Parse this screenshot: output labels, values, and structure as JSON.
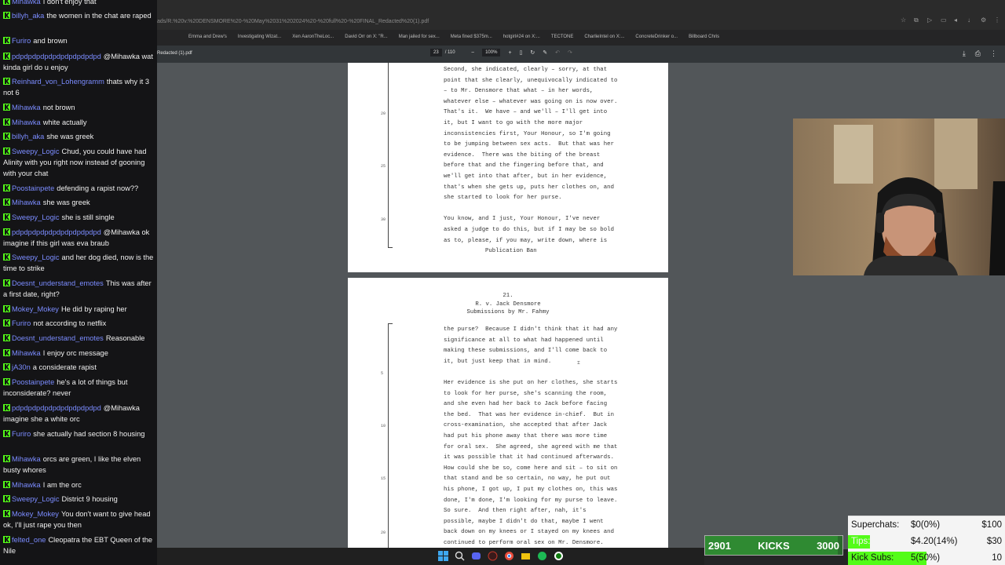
{
  "browser": {
    "url": "ads/R.%20v.%20DENSMORE%20-%20May%2031%202024%20-%20full%20-%20FINAL_Redacted%20(1).pdf",
    "bookmarks": [
      "Emma and Drew's",
      "Investigating Wizat...",
      "Xen AaronTheLoc...",
      "David Orr on X: \"R...",
      "Man jailed for sex...",
      "Meta fined $375m...",
      "hotgirl#24 on X:...",
      "TECTONE",
      "CharlieIntel on X:...",
      "ConcreteDrinker o...",
      "Billboard Chris"
    ]
  },
  "pdf_toolbar": {
    "filename": "Redacted (1).pdf",
    "current_page": "23",
    "total_pages": "/ 110",
    "zoom": "100%"
  },
  "page1": {
    "lines": [
      "Second, she indicated, clearly – sorry, at that",
      "point that she clearly, unequivocally indicated to",
      "– to Mr. Densmore that what – in her words,",
      "whatever else – whatever was going on is now over.",
      "That's it.  We have – and we'll – I'll get into",
      "it, but I want to go with the more major",
      "inconsistencies first, Your Honour, so I'm going",
      "to be jumping between sex acts.  But that was her",
      "evidence.  There was the biting of the breast",
      "before that and the fingering before that, and",
      "we'll get into that after, but in her evidence,",
      "that's when she gets up, puts her clothes on, and",
      "she started to look for her purse.",
      "",
      "You know, and I just, Your Honour, I've never",
      "asked a judge to do this, but if I may be so bold",
      "as to, please, if you may, write down, where is"
    ],
    "footer": "Publication Ban",
    "line_numbers": [
      "20",
      "25",
      "30"
    ]
  },
  "page2": {
    "page_no": "21.",
    "header_line1": "R. v. Jack Densmore",
    "header_line2": "Submissions by Mr. Fahmy",
    "lines": [
      "the purse?  Because I didn't think that it had any",
      "significance at all to what had happened until",
      "making these submissions, and I'll come back to",
      "it, but just keep that in mind.",
      "",
      "Her evidence is she put on her clothes, she starts",
      "to look for her purse, she's scanning the room,",
      "and she even had her back to Jack before facing",
      "the bed.  That was her evidence in-chief.  But in",
      "cross-examination, she accepted that after Jack",
      "had put his phone away that there was more time",
      "for oral sex.  She agreed, she agreed with me that",
      "it was possible that it had continued afterwards.",
      "How could she be so, come here and sit – to sit on",
      "that stand and be so certain, no way, he put out",
      "his phone, I got up, I put my clothes on, this was",
      "done, I'm done, I'm looking for my purse to leave.",
      "So sure.  And then right after, nah, it's",
      "possible, maybe I didn't do that, maybe I went",
      "back down on my knees or I stayed on my knees and",
      "continued to perform oral sex on Mr. Densmore."
    ],
    "line_numbers": [
      "5",
      "10",
      "15",
      "20"
    ]
  },
  "chat": [
    {
      "user": "Mihawka",
      "text": "I don't enjoy that",
      "color": "#7b8cff"
    },
    {
      "user": "billyh_aka",
      "text": "the women in the chat are raped",
      "color": "#7b8cff"
    },
    {
      "user": "Furiro",
      "text": "and brown",
      "color": "#7b8cff"
    },
    {
      "user": "pdpdpdpdpdpdpdpdpdpdpd",
      "text": "@Mihawka wat kinda girl do u enjoy",
      "color": "#7b8cff"
    },
    {
      "user": "Reinhard_von_Lohengramm",
      "text": "thats why it 3 not 6",
      "color": "#7b8cff"
    },
    {
      "user": "Mihawka",
      "text": "not brown",
      "color": "#7b8cff"
    },
    {
      "user": "Mihawka",
      "text": "white actually",
      "color": "#7b8cff"
    },
    {
      "user": "billyh_aka",
      "text": "she was greek",
      "color": "#7b8cff"
    },
    {
      "user": "Sweepy_Logic",
      "text": "Chud, you could have had Alinity with you right now instead of gooning with your chat",
      "color": "#7b8cff"
    },
    {
      "user": "Poostainpete",
      "text": "defending a rapist now??",
      "color": "#7b8cff"
    },
    {
      "user": "Mihawka",
      "text": "she was greek",
      "color": "#7b8cff"
    },
    {
      "user": "Sweepy_Logic",
      "text": "she is still single",
      "color": "#7b8cff"
    },
    {
      "user": "pdpdpdpdpdpdpdpdpdpdpd",
      "text": "@Mihawka ok imagine if this girl was eva braub",
      "color": "#7b8cff"
    },
    {
      "user": "Sweepy_Logic",
      "text": "and her dog died, now is the time to strike",
      "color": "#7b8cff"
    },
    {
      "user": "Doesnt_understand_emotes",
      "text": "This was after a first date, right?",
      "color": "#7b8cff"
    },
    {
      "user": "Mokey_Mokey",
      "text": "He did by raping her",
      "color": "#7b8cff"
    },
    {
      "user": "Furiro",
      "text": "not according to netflix",
      "color": "#7b8cff"
    },
    {
      "user": "Doesnt_understand_emotes",
      "text": "Reasonable",
      "color": "#7b8cff"
    },
    {
      "user": "Mihawka",
      "text": "I enjoy orc message",
      "color": "#7b8cff"
    },
    {
      "user": "jA30n",
      "text": "a considerate rapist",
      "color": "#7b8cff"
    },
    {
      "user": "Poostainpete",
      "text": "he's a lot of things but inconsiderate? never",
      "color": "#7b8cff"
    },
    {
      "user": "pdpdpdpdpdpdpdpdpdpdpd",
      "text": "@Mihawka imagine she a white orc",
      "color": "#7b8cff"
    },
    {
      "user": "Furiro",
      "text": "she actually had section 8 housing",
      "color": "#7b8cff"
    },
    {
      "user": "Mihawka",
      "text": "orcs are green, I like the elven busty whores",
      "color": "#7b8cff"
    },
    {
      "user": "Mihawka",
      "text": "I am the orc",
      "color": "#7b8cff"
    },
    {
      "user": "Sweepy_Logic",
      "text": "District 9 housing",
      "color": "#7b8cff"
    },
    {
      "user": "Mokey_Mokey",
      "text": "You don't want to give head ok, I'll just rape you then",
      "color": "#7b8cff"
    },
    {
      "user": "felted_one",
      "text": "Cleopatra the EBT Queen of the Nile",
      "color": "#7b8cff"
    }
  ],
  "kicks": {
    "current": "2901",
    "label": "KICKS",
    "target": "3000",
    "progress": 0.967
  },
  "goals": [
    {
      "label": "Superchats:",
      "value": "$0(0%)",
      "target": "$100",
      "progress": 0.0
    },
    {
      "label": "Tips:",
      "value": "$4.20(14%)",
      "target": "$30",
      "progress": 0.14
    },
    {
      "label": "Kick Subs:",
      "value": "5(50%)",
      "target": "10",
      "progress": 0.5
    }
  ],
  "colors": {
    "kick_green": "#53fc18",
    "chat_bg": "#121214",
    "pdf_bg": "#525659"
  }
}
